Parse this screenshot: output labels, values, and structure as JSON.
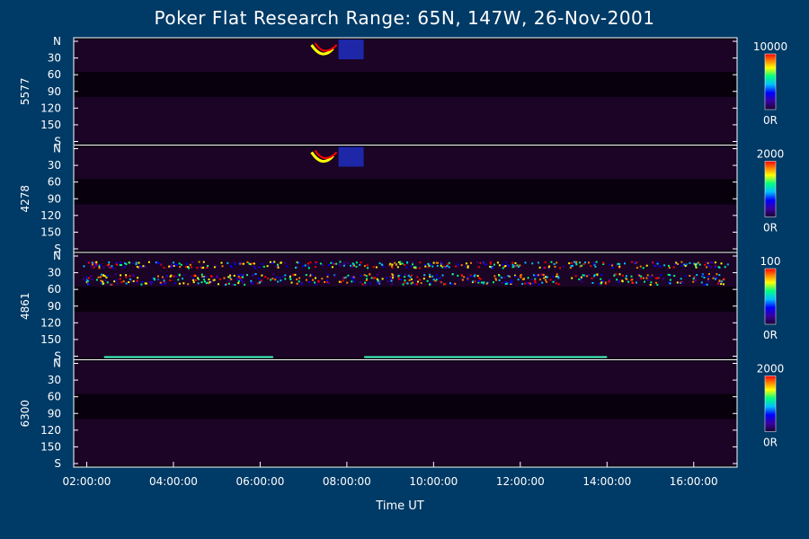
{
  "chart_data": {
    "type": "heatmap",
    "title": "Poker Flat Research Range: 65N, 147W, 26-Nov-2001",
    "xlabel": "Time UT",
    "x_ticks": [
      "02:00:00",
      "04:00:00",
      "06:00:00",
      "08:00:00",
      "10:00:00",
      "12:00:00",
      "14:00:00",
      "16:00:00"
    ],
    "x_range_hours": [
      1.7,
      17.0
    ],
    "y_tick_labels": [
      "N",
      "30",
      "60",
      "90",
      "120",
      "150",
      "S"
    ],
    "y_range": [
      0,
      180
    ],
    "panels": [
      {
        "label": "5577",
        "scale_max": "10000",
        "scale_min": "0R"
      },
      {
        "label": "4278",
        "scale_max": "2000",
        "scale_min": "0R"
      },
      {
        "label": "4861",
        "scale_max": "100",
        "scale_min": "0R"
      },
      {
        "label": "6300",
        "scale_max": "2000",
        "scale_min": "0R"
      }
    ],
    "colormap": [
      "#1a0030",
      "#3a00a0",
      "#0000ff",
      "#00c0ff",
      "#00ff80",
      "#ffff00",
      "#ff8000",
      "#ff0000"
    ]
  }
}
